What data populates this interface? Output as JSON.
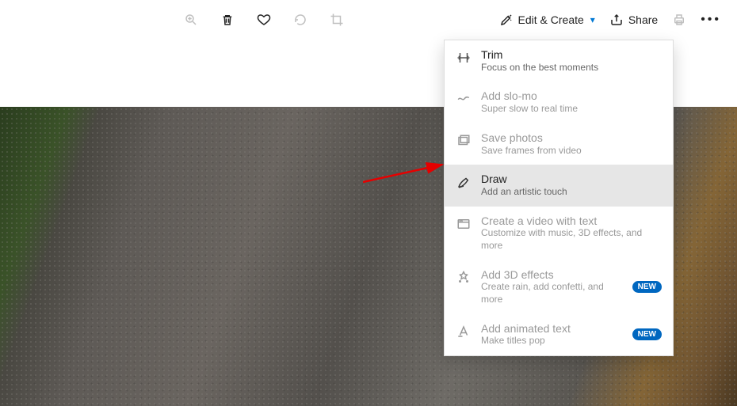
{
  "toolbar": {
    "edit_create_label": "Edit & Create",
    "share_label": "Share"
  },
  "menu": {
    "items": [
      {
        "title": "Trim",
        "subtitle": "Focus on the best moments"
      },
      {
        "title": "Add slo-mo",
        "subtitle": "Super slow to real time"
      },
      {
        "title": "Save photos",
        "subtitle": "Save frames from video"
      },
      {
        "title": "Draw",
        "subtitle": "Add an artistic touch"
      },
      {
        "title": "Create a video with text",
        "subtitle": "Customize with music, 3D effects, and more"
      },
      {
        "title": "Add 3D effects",
        "subtitle": "Create rain, add confetti, and more",
        "badge": "NEW"
      },
      {
        "title": "Add animated text",
        "subtitle": "Make titles pop",
        "badge": "NEW"
      }
    ]
  }
}
